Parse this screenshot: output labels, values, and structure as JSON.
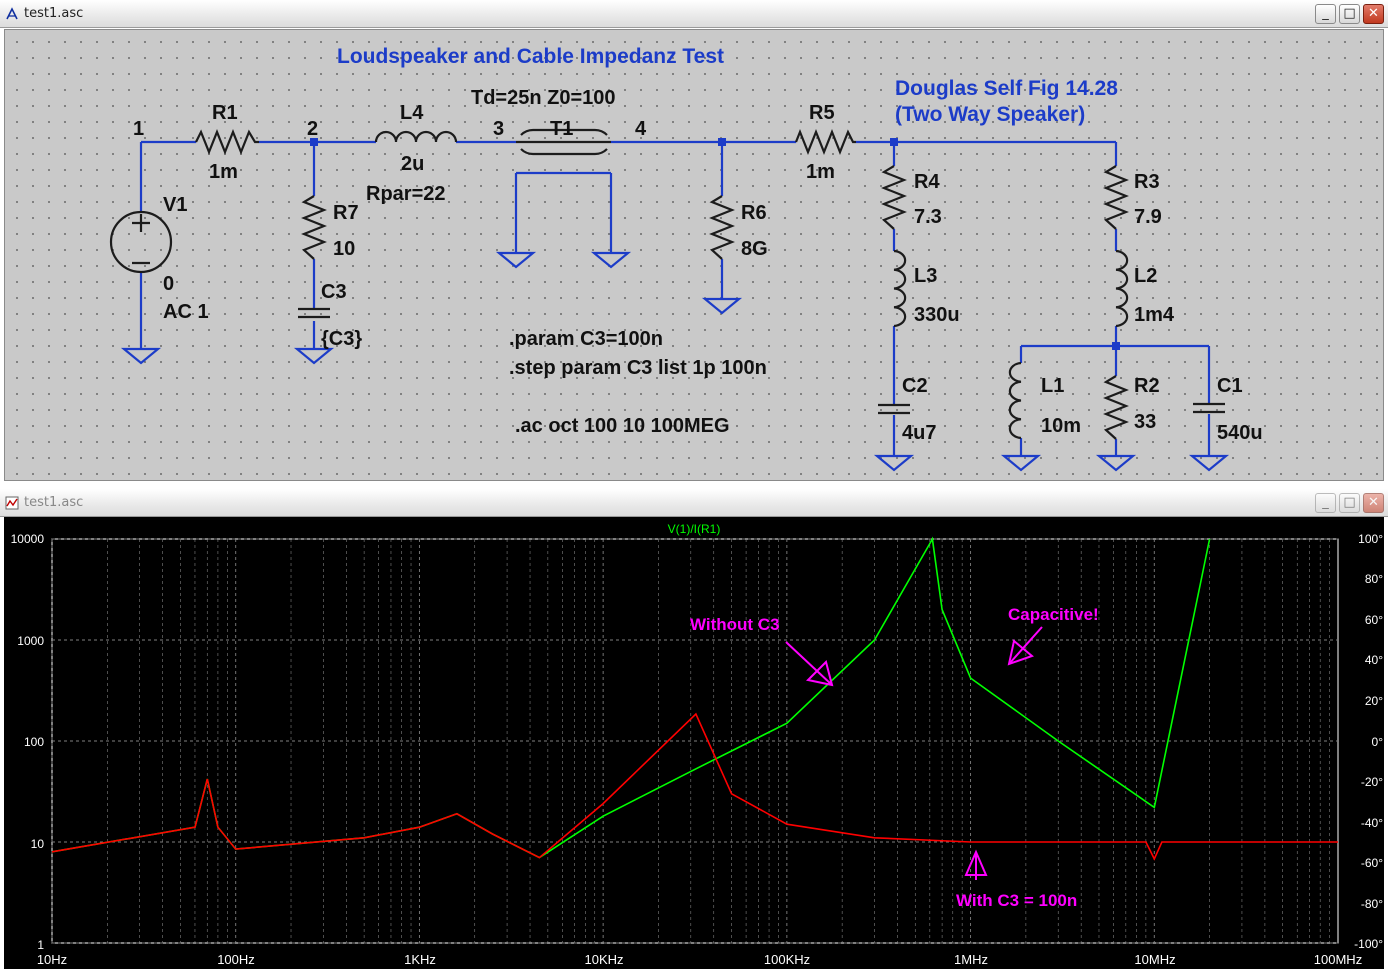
{
  "schematic_window": {
    "title": "test1.asc",
    "buttons": {
      "minimize": "_",
      "maximize": "□",
      "close": "✕"
    }
  },
  "plot_window": {
    "title": "test1.asc",
    "buttons": {
      "minimize": "_",
      "maximize": "□",
      "close": "✕"
    }
  },
  "schematic": {
    "title": "Loudspeaker and Cable Impedanz Test",
    "reference_line1": "Douglas Self Fig 14.28",
    "reference_line2": "(Two Way Speaker)",
    "line_params": "Td=25n Z0=100",
    "nodes": [
      "1",
      "2",
      "3",
      "4"
    ],
    "components": {
      "R1": {
        "name": "R1",
        "value": "1m"
      },
      "L4": {
        "name": "L4",
        "value": "2u",
        "extra": "Rpar=22"
      },
      "T1": {
        "name": "T1"
      },
      "R5": {
        "name": "R5",
        "value": "1m"
      },
      "V1": {
        "name": "V1",
        "value": "0",
        "extra": "AC 1"
      },
      "R7": {
        "name": "R7",
        "value": "10"
      },
      "C3": {
        "name": "C3",
        "value": "{C3}"
      },
      "R6": {
        "name": "R6",
        "value": "8G"
      },
      "R4": {
        "name": "R4",
        "value": "7.3"
      },
      "L3": {
        "name": "L3",
        "value": "330u"
      },
      "C2": {
        "name": "C2",
        "value": "4u7"
      },
      "R3": {
        "name": "R3",
        "value": "7.9"
      },
      "L2": {
        "name": "L2",
        "value": "1m4"
      },
      "L1": {
        "name": "L1",
        "value": "10m"
      },
      "R2": {
        "name": "R2",
        "value": "33"
      },
      "C1": {
        "name": "C1",
        "value": "540u"
      }
    },
    "directives": [
      ".param C3=100n",
      ".step param C3 list 1p 100n",
      ".ac oct 100 10 100MEG"
    ]
  },
  "plot": {
    "trace_title": "V(1)/I(R1)",
    "left_ticks": [
      "10000",
      "1000",
      "100",
      "10",
      "1"
    ],
    "right_ticks": [
      "100°",
      "80°",
      "60°",
      "40°",
      "20°",
      "0°",
      "-20°",
      "-40°",
      "-60°",
      "-80°",
      "-100°"
    ],
    "x_ticks": [
      "10Hz",
      "100Hz",
      "1KHz",
      "10KHz",
      "100KHz",
      "1MHz",
      "10MHz",
      "100MHz"
    ],
    "annotations": {
      "without_c3": "Without C3",
      "capacitive": "Capacitive!",
      "with_c3": "With C3 = 100n"
    },
    "colors": {
      "background": "#000000",
      "without_c3": "#00ff00",
      "with_c3": "#ff0000",
      "annotation": "#ff00ff",
      "grid": "#808080"
    }
  },
  "chart_data": {
    "type": "line",
    "title": "V(1)/I(R1)",
    "x_scale": "log",
    "xlim": [
      10,
      100000000
    ],
    "ylim_left": [
      1,
      10000
    ],
    "y_scale_left": "log",
    "ylim_right": [
      -100,
      100
    ],
    "grid": true,
    "series": [
      {
        "name": "Without C3",
        "color": "#00ff00",
        "x": [
          10,
          60,
          70,
          80,
          100,
          500,
          1000,
          1600,
          2500,
          4500,
          10000,
          30000,
          100000,
          300000,
          600000,
          620000,
          700000,
          1000000,
          3000000,
          10000000,
          20000000
        ],
        "magnitude": [
          8,
          14,
          42,
          14,
          8.5,
          11,
          14,
          19,
          12,
          7,
          18,
          50,
          150,
          1000,
          9000,
          10000,
          2000,
          420,
          100,
          22,
          10000
        ]
      },
      {
        "name": "With C3 = 100n",
        "color": "#ff0000",
        "x": [
          10,
          60,
          70,
          80,
          100,
          500,
          1000,
          1600,
          2500,
          4500,
          10000,
          32000,
          50000,
          100000,
          300000,
          1000000,
          9000000,
          10000000,
          11000000,
          100000000
        ],
        "magnitude": [
          8,
          14,
          42,
          14,
          8.5,
          11,
          14,
          19,
          12,
          7,
          24,
          185,
          30,
          15,
          11,
          10,
          10,
          6.8,
          10,
          10
        ]
      }
    ]
  }
}
